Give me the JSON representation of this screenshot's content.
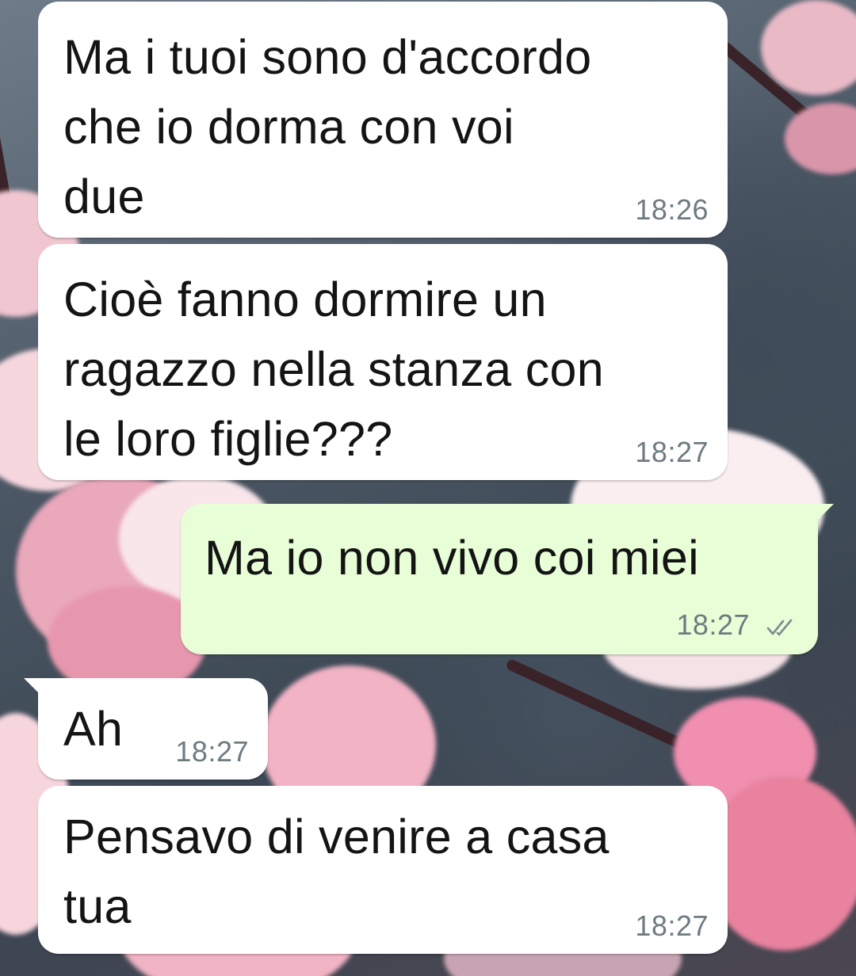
{
  "chat": {
    "messages": [
      {
        "direction": "incoming",
        "text": "Ma i tuoi sono d'accordo\nche io dorma con voi\ndue",
        "time": "18:26"
      },
      {
        "direction": "incoming",
        "text": "Cioè fanno dormire un\nragazzo nella stanza con\nle loro figlie???",
        "time": "18:27"
      },
      {
        "direction": "outgoing",
        "text": "Ma io non vivo coi miei",
        "time": "18:27",
        "status_icon": "double-check-icon"
      },
      {
        "direction": "incoming",
        "text": "Ah",
        "time": "18:27"
      },
      {
        "direction": "incoming",
        "text": "Pensavo di venire a casa\ntua",
        "time": "18:27"
      }
    ]
  },
  "colors": {
    "incoming_bubble": "#ffffff",
    "outgoing_bubble": "#e7fed7",
    "time_text": "#6e7b80",
    "tick": "#7d8a8f",
    "wallpaper_dark": "#3f4b58",
    "blossom_pink": "#f3bccb"
  }
}
